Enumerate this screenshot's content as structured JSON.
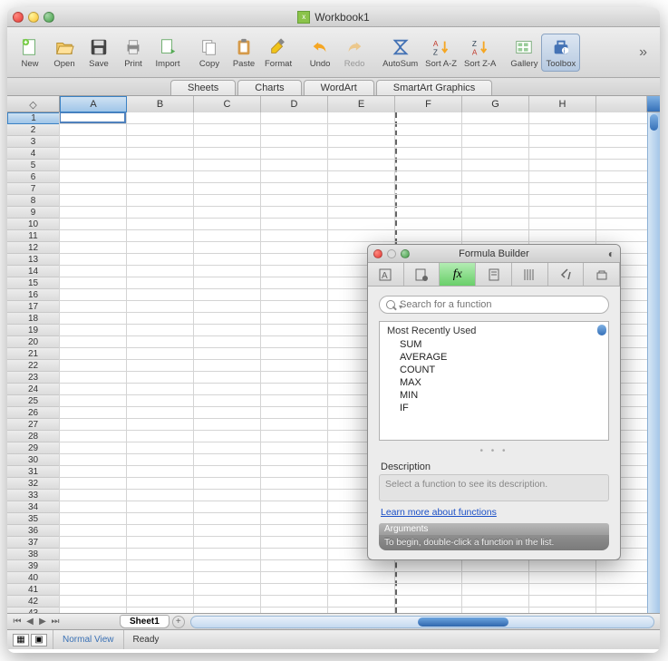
{
  "window": {
    "title": "Workbook1"
  },
  "toolbar": [
    {
      "id": "new",
      "label": "New"
    },
    {
      "id": "open",
      "label": "Open"
    },
    {
      "id": "save",
      "label": "Save"
    },
    {
      "id": "print",
      "label": "Print"
    },
    {
      "id": "import",
      "label": "Import"
    },
    {
      "id": "copy",
      "label": "Copy"
    },
    {
      "id": "paste",
      "label": "Paste"
    },
    {
      "id": "format",
      "label": "Format"
    },
    {
      "id": "undo",
      "label": "Undo"
    },
    {
      "id": "redo",
      "label": "Redo"
    },
    {
      "id": "autosum",
      "label": "AutoSum"
    },
    {
      "id": "sort-az",
      "label": "Sort A-Z"
    },
    {
      "id": "sort-za",
      "label": "Sort Z-A"
    },
    {
      "id": "gallery",
      "label": "Gallery"
    },
    {
      "id": "toolbox",
      "label": "Toolbox"
    }
  ],
  "ribbon_tabs": [
    "Sheets",
    "Charts",
    "WordArt",
    "SmartArt Graphics"
  ],
  "columns": [
    "A",
    "B",
    "C",
    "D",
    "E",
    "F",
    "G",
    "H"
  ],
  "rows_start": 1,
  "rows_end": 43,
  "active_cell": {
    "col": "A",
    "row": 1
  },
  "sheet": {
    "name": "Sheet1"
  },
  "status": {
    "view": "Normal View",
    "state": "Ready"
  },
  "formula_builder": {
    "title": "Formula Builder",
    "search_placeholder": "Search for a function",
    "list_header": "Most Recently Used",
    "items": [
      "SUM",
      "AVERAGE",
      "COUNT",
      "MAX",
      "MIN",
      "IF"
    ],
    "description_label": "Description",
    "description_text": "Select a function to see its description.",
    "link_text": "Learn more about functions",
    "arguments_label": "Arguments",
    "arguments_hint": "To begin, double-click a function in the list."
  }
}
